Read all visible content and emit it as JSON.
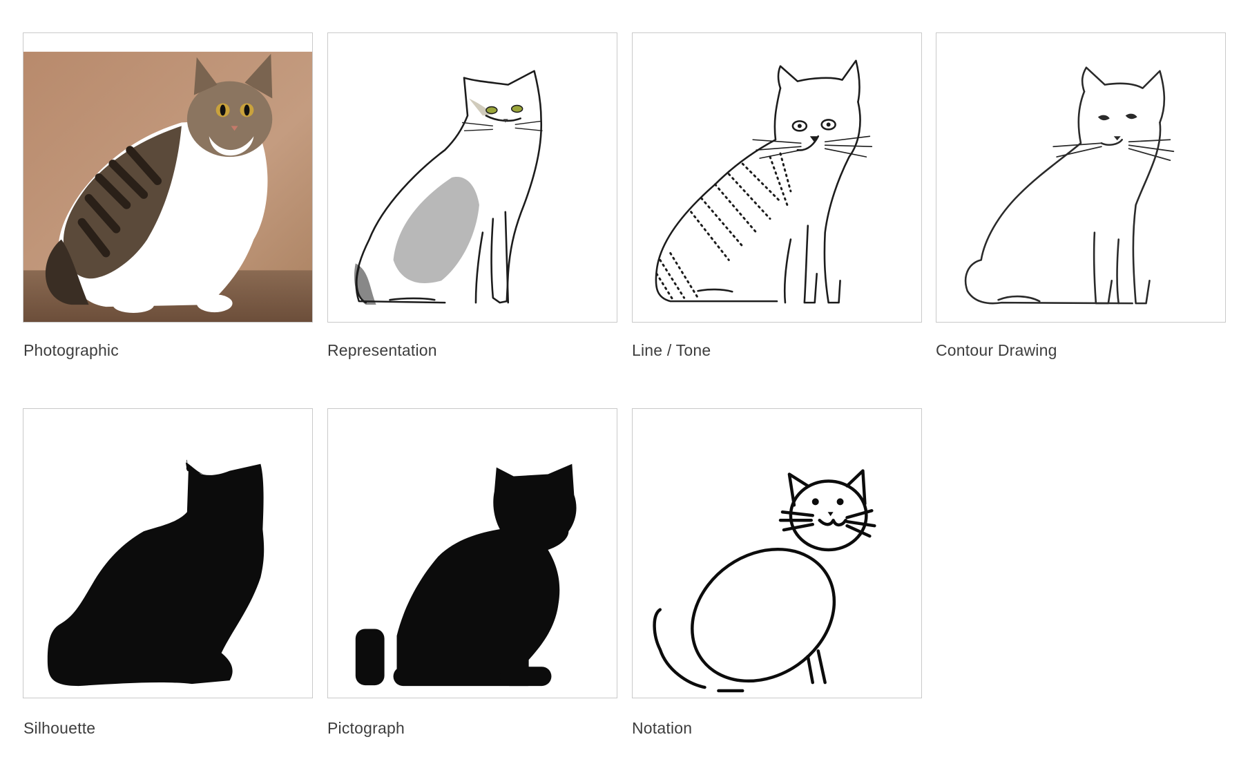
{
  "tiles": [
    {
      "id": "photographic",
      "label": "Photographic"
    },
    {
      "id": "representation",
      "label": "Representation"
    },
    {
      "id": "line-tone",
      "label": "Line / Tone"
    },
    {
      "id": "contour-drawing",
      "label": "Contour Drawing"
    },
    {
      "id": "silhouette",
      "label": "Silhouette"
    },
    {
      "id": "pictograph",
      "label": "Pictograph"
    },
    {
      "id": "notation",
      "label": "Notation"
    }
  ],
  "colors": {
    "background": "#ffffff",
    "tile_border": "#c9c9c9",
    "caption_text": "#3d3d3d",
    "photo_backdrop": "#b88e72",
    "photo_floor": "#7a5a44",
    "ink": "#111111"
  }
}
